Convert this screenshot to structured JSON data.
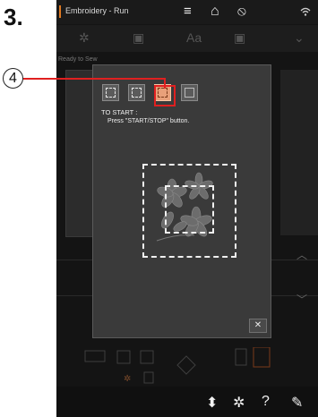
{
  "step_label": "3.",
  "callout_number": "4",
  "window": {
    "title": "Embroidery - Run",
    "menu_icon": "≡",
    "home_icon": "⌂",
    "status_icon": "⦸",
    "wifi_icon": "wifi-icon"
  },
  "background": {
    "ready_text": "Ready to Sew",
    "tool_icons": [
      "✲",
      "▣",
      "Aa",
      "▣",
      "⌄"
    ]
  },
  "dialog": {
    "to_start": "TO START :",
    "press_text": "Press \"START/STOP\" button.",
    "close_label": "✕",
    "thumbnails": [
      {
        "name": "hoop-option-1",
        "selected": false
      },
      {
        "name": "hoop-option-2",
        "selected": false
      },
      {
        "name": "hoop-option-3",
        "selected": true
      },
      {
        "name": "hoop-option-4",
        "selected": false
      }
    ]
  },
  "bottom_bar": {
    "icons": [
      "⬍",
      "✲",
      "?",
      "✎"
    ]
  },
  "colors": {
    "accent": "#e07a22",
    "callout_line": "#e02020",
    "dialog_bg": "#3a3a3a",
    "selected_thumb": "#e8a07a"
  }
}
